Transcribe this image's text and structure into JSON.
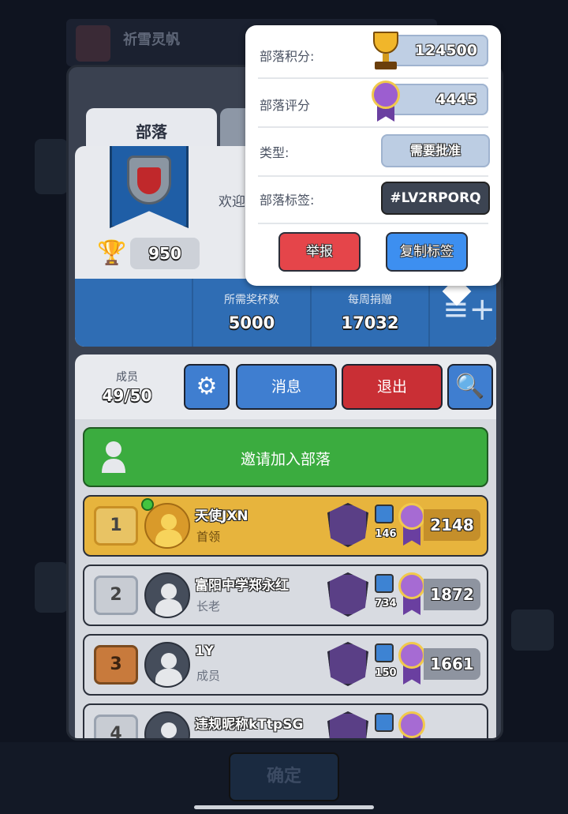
{
  "background": {
    "clan_name": "祈雪灵帆",
    "ok_button": "确定"
  },
  "tabs": [
    {
      "label": "部落",
      "active": true
    },
    {
      "label": "",
      "active": false
    }
  ],
  "clan_card": {
    "welcome_text": "欢迎加",
    "trophies": "950",
    "required_trophies_label": "所需奖杯数",
    "required_trophies_value": "5000",
    "weekly_donations_label": "每周捐赠",
    "weekly_donations_value": "17032"
  },
  "member_bar": {
    "members_label": "成员",
    "members_value": "49/50",
    "message_button": "消息",
    "exit_button": "退出"
  },
  "invite_button": "邀请加入部落",
  "members": [
    {
      "rank": "1",
      "name": "天使JXN",
      "role": "首领",
      "donations": "146",
      "trophies": "2148",
      "online": true
    },
    {
      "rank": "2",
      "name": "富阳中学郑永红",
      "role": "长老",
      "donations": "734",
      "trophies": "1872",
      "online": false
    },
    {
      "rank": "3",
      "name": "1Y",
      "role": "成员",
      "donations": "150",
      "trophies": "1661",
      "online": false
    },
    {
      "rank": "4",
      "name": "违规昵称kTtpSG",
      "role": "",
      "donations": "",
      "trophies": "",
      "online": false
    }
  ],
  "popup": {
    "clan_score_label": "部落积分:",
    "clan_score_value": "124500",
    "clan_rating_label": "部落评分",
    "clan_rating_value": "4445",
    "type_label": "类型:",
    "type_value": "需要批准",
    "tag_label": "部落标签:",
    "tag_value": "#LV2RPORQ",
    "report_button": "举报",
    "copy_tag_button": "复制标签"
  },
  "colors": {
    "accent_blue": "#3f7ed0",
    "exit_red": "#c92f35",
    "invite_green": "#3bac3f",
    "leader_gold": "#e7b43d"
  }
}
